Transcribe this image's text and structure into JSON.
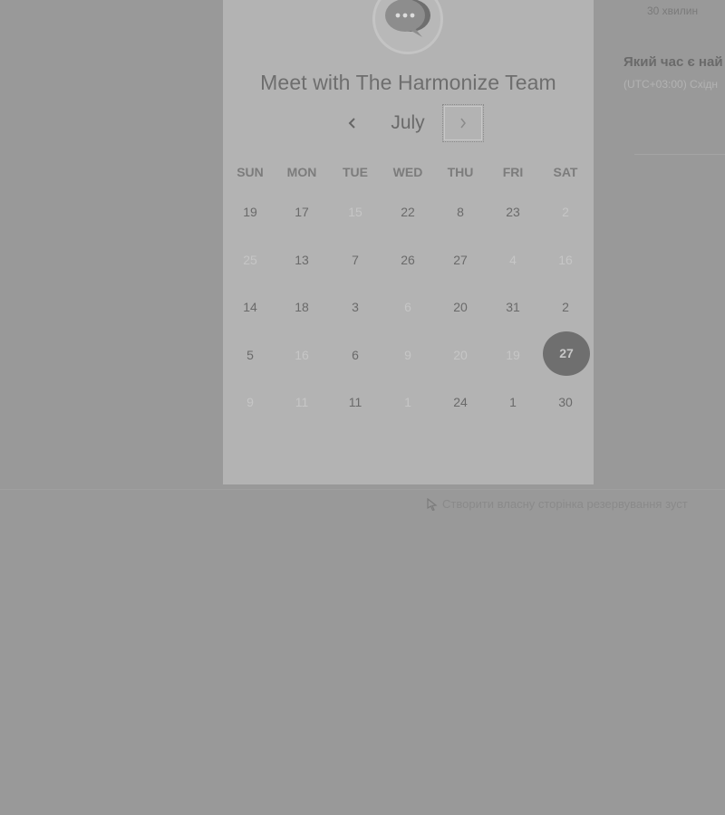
{
  "widget": {
    "title": "Meet with The Harmonize Team",
    "avatar_icon": "chat-bubbles-icon"
  },
  "calendar": {
    "month": "July",
    "prev_icon": "chevron-left-icon",
    "next_icon": "chevron-right-icon",
    "weekdays": [
      "SUN",
      "MON",
      "TUE",
      "WED",
      "THU",
      "FRI",
      "SAT"
    ],
    "weeks": [
      [
        {
          "d": "19",
          "faded": false
        },
        {
          "d": "17",
          "faded": false
        },
        {
          "d": "15",
          "faded": true
        },
        {
          "d": "22",
          "faded": false
        },
        {
          "d": "8",
          "faded": false
        },
        {
          "d": "23",
          "faded": false
        },
        {
          "d": "2",
          "faded": true
        }
      ],
      [
        {
          "d": "25",
          "faded": true
        },
        {
          "d": "13",
          "faded": false
        },
        {
          "d": "7",
          "faded": false
        },
        {
          "d": "26",
          "faded": false
        },
        {
          "d": "27",
          "faded": false
        },
        {
          "d": "4",
          "faded": true
        },
        {
          "d": "16",
          "faded": true
        }
      ],
      [
        {
          "d": "14",
          "faded": false
        },
        {
          "d": "18",
          "faded": false
        },
        {
          "d": "3",
          "faded": false
        },
        {
          "d": "6",
          "faded": true
        },
        {
          "d": "20",
          "faded": false
        },
        {
          "d": "31",
          "faded": false
        },
        {
          "d": "2",
          "faded": false
        }
      ],
      [
        {
          "d": "5",
          "faded": false
        },
        {
          "d": "16",
          "faded": true
        },
        {
          "d": "6",
          "faded": false
        },
        {
          "d": "9",
          "faded": true
        },
        {
          "d": "20",
          "faded": true
        },
        {
          "d": "19",
          "faded": true
        },
        {
          "d": "27",
          "faded": false,
          "selected": true
        }
      ],
      [
        {
          "d": "9",
          "faded": true
        },
        {
          "d": "11",
          "faded": true
        },
        {
          "d": "11",
          "faded": false
        },
        {
          "d": "1",
          "faded": true
        },
        {
          "d": "24",
          "faded": false
        },
        {
          "d": "1",
          "faded": false
        },
        {
          "d": "30",
          "faded": false
        }
      ]
    ]
  },
  "sidebar": {
    "duration": "30 хвилин",
    "question": "Який час є най",
    "timezone": "(UTC+03:00) Східн"
  },
  "footer": {
    "link_icon": "pointer-icon",
    "link_text": "Створити власну сторінка резервування зуст"
  },
  "colors": {
    "backdrop": "#999999",
    "card": "#b3b3b3",
    "selected": "#6f6f6f"
  }
}
